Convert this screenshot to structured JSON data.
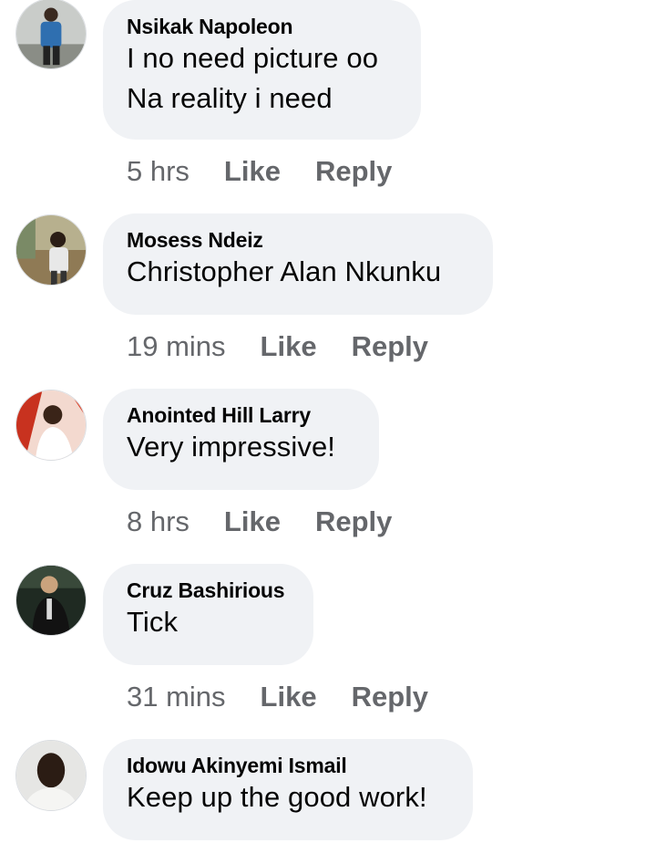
{
  "comments": [
    {
      "author": "Nsikak Napoleon",
      "text_lines": [
        "I no need picture oo",
        "Na reality i need"
      ],
      "time": "5 hrs",
      "like_label": "Like",
      "reply_label": "Reply"
    },
    {
      "author": "Mosess Ndeiz",
      "text_lines": [
        "Christopher Alan Nkunku"
      ],
      "time": "19 mins",
      "like_label": "Like",
      "reply_label": "Reply"
    },
    {
      "author": "Anointed Hill Larry",
      "text_lines": [
        "Very impressive!"
      ],
      "time": "8 hrs",
      "like_label": "Like",
      "reply_label": "Reply"
    },
    {
      "author": "Cruz Bashirious",
      "text_lines": [
        "Tick"
      ],
      "time": "31 mins",
      "like_label": "Like",
      "reply_label": "Reply"
    },
    {
      "author": "Idowu Akinyemi Ismail",
      "text_lines": [
        "Keep up the good work!"
      ]
    }
  ],
  "colors": {
    "bubble_bg": "#f0f2f5",
    "name_text": "#050505",
    "action_text": "#65676b"
  }
}
